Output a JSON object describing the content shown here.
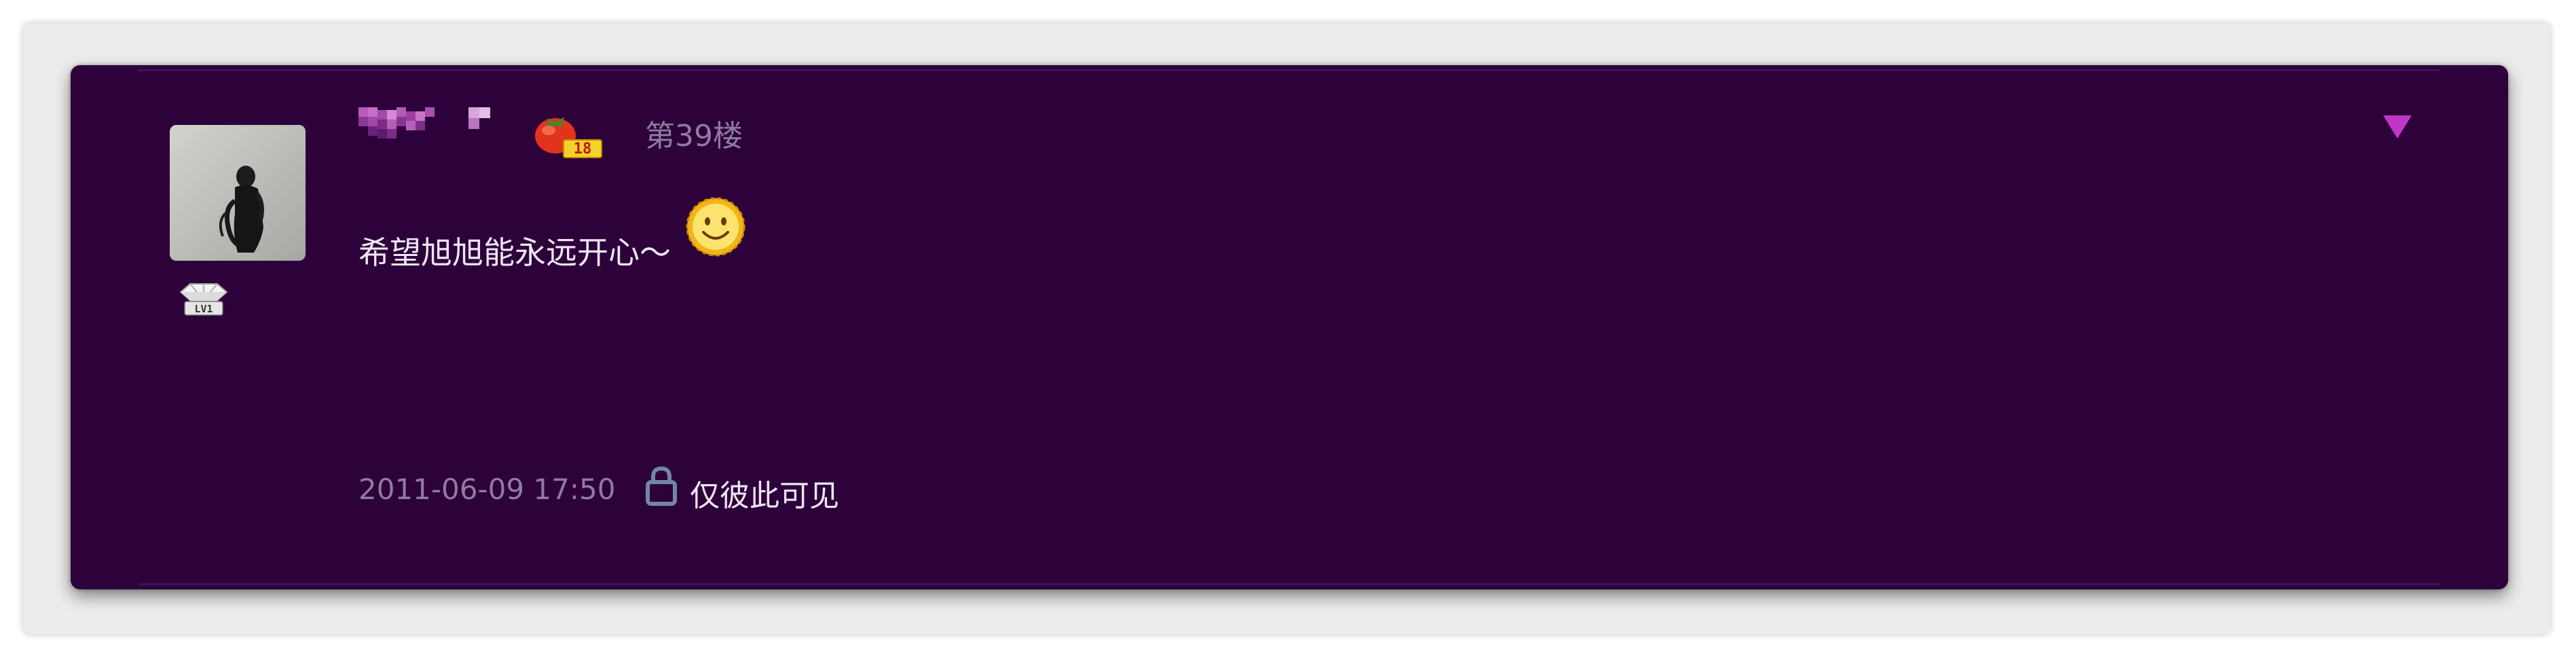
{
  "post": {
    "floor_label": "第39楼",
    "content": "希望旭旭能永远开心～",
    "timestamp": "2011-06-09 17:50",
    "visibility_label": "仅彼此可见",
    "user_level_badge": "LV1",
    "medal_number": "18"
  },
  "icons": {
    "menu": "triangle-down-icon",
    "lock": "lock-icon",
    "emoji": "smiley-face-icon",
    "medal": "tomato-medal-icon",
    "level": "diamond-badge-icon"
  },
  "colors": {
    "card_background": "#2d0139",
    "muted_text": "#8f7ba2",
    "body_text": "#efe6f4",
    "accent_arrow": "#c235c9"
  }
}
